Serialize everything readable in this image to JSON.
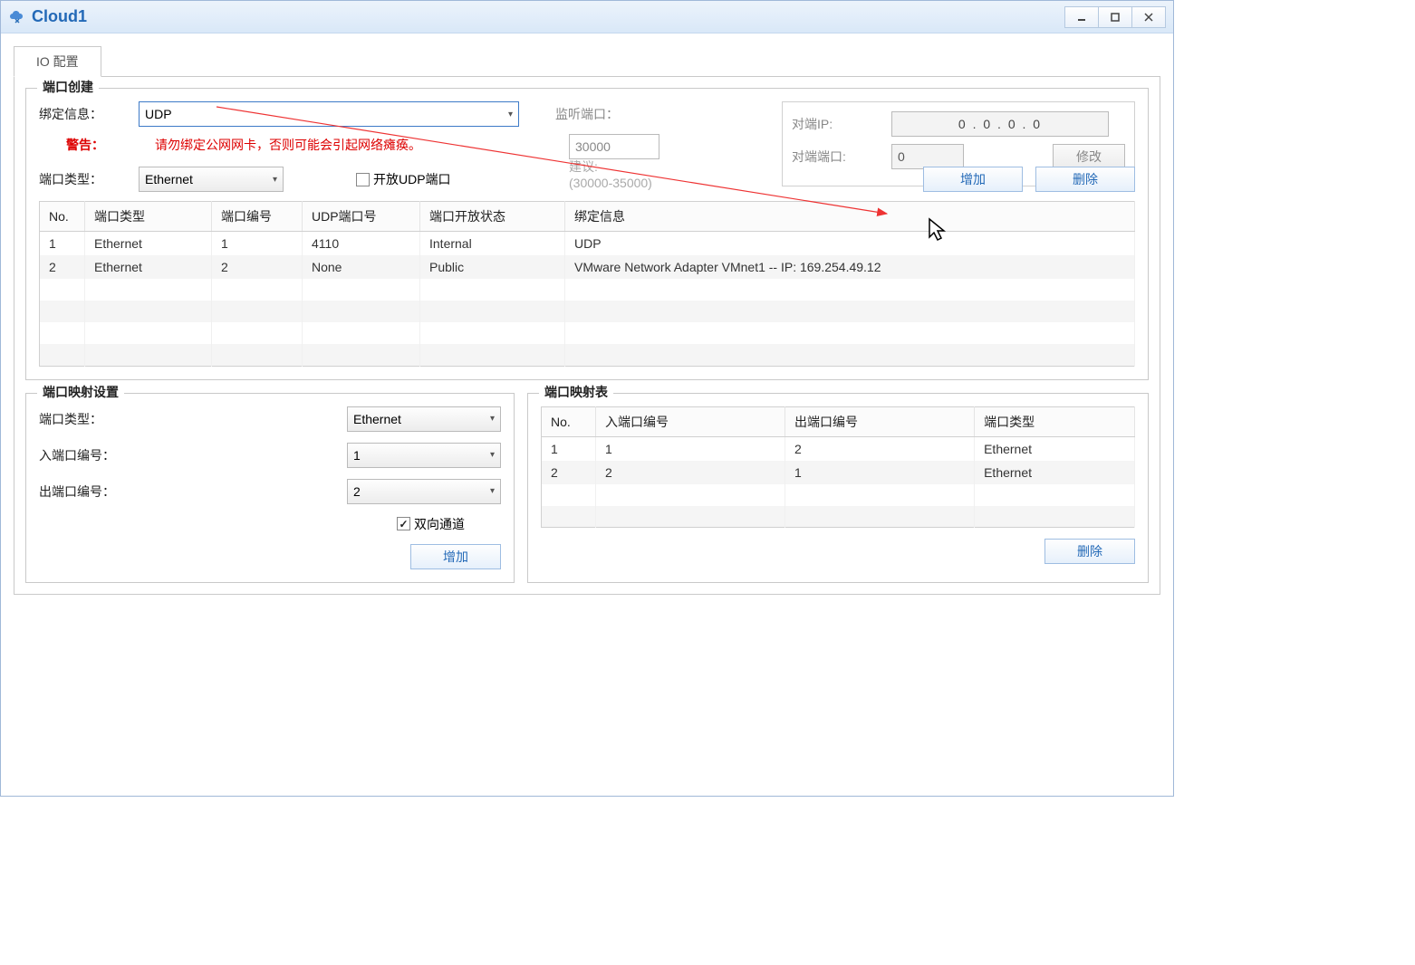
{
  "window": {
    "title": "Cloud1"
  },
  "tab": {
    "label": "IO 配置"
  },
  "portCreate": {
    "legend": "端口创建",
    "bindInfoLabel": "绑定信息：",
    "bindInfoValue": "UDP",
    "warningLabel": "警告：",
    "warningText": "请勿绑定公网网卡，否则可能会引起网络瘫痪。",
    "portTypeLabel": "端口类型：",
    "portTypeValue": "Ethernet",
    "openUdpLabel": "开放UDP端口",
    "listenPortLabel": "监听端口：",
    "listenPortValue": "30000",
    "suggestLabel": "建议:",
    "suggestRange": "(30000-35000)",
    "peerIpLabel": "对端IP:",
    "peerIpValue": "0   .   0   .   0   .   0",
    "peerPortLabel": "对端端口:",
    "peerPortValue": "0",
    "modifyBtn": "修改",
    "addBtn": "增加",
    "deleteBtn": "删除",
    "table": {
      "headers": [
        "No.",
        "端口类型",
        "端口编号",
        "UDP端口号",
        "端口开放状态",
        "绑定信息"
      ],
      "rows": [
        {
          "no": "1",
          "type": "Ethernet",
          "idx": "1",
          "udp": "4110",
          "state": "Internal",
          "bind": "UDP"
        },
        {
          "no": "2",
          "type": "Ethernet",
          "idx": "2",
          "udp": "None",
          "state": "Public",
          "bind": "VMware Network Adapter VMnet1 -- IP: 169.254.49.12"
        }
      ]
    }
  },
  "mapSetting": {
    "legend": "端口映射设置",
    "portTypeLabel": "端口类型：",
    "portTypeValue": "Ethernet",
    "inPortLabel": "入端口编号：",
    "inPortValue": "1",
    "outPortLabel": "出端口编号：",
    "outPortValue": "2",
    "bidirLabel": "双向通道",
    "addBtn": "增加"
  },
  "mapTable": {
    "legend": "端口映射表",
    "headers": [
      "No.",
      "入端口编号",
      "出端口编号",
      "端口类型"
    ],
    "rows": [
      {
        "no": "1",
        "in": "1",
        "out": "2",
        "type": "Ethernet"
      },
      {
        "no": "2",
        "in": "2",
        "out": "1",
        "type": "Ethernet"
      }
    ],
    "deleteBtn": "删除"
  }
}
